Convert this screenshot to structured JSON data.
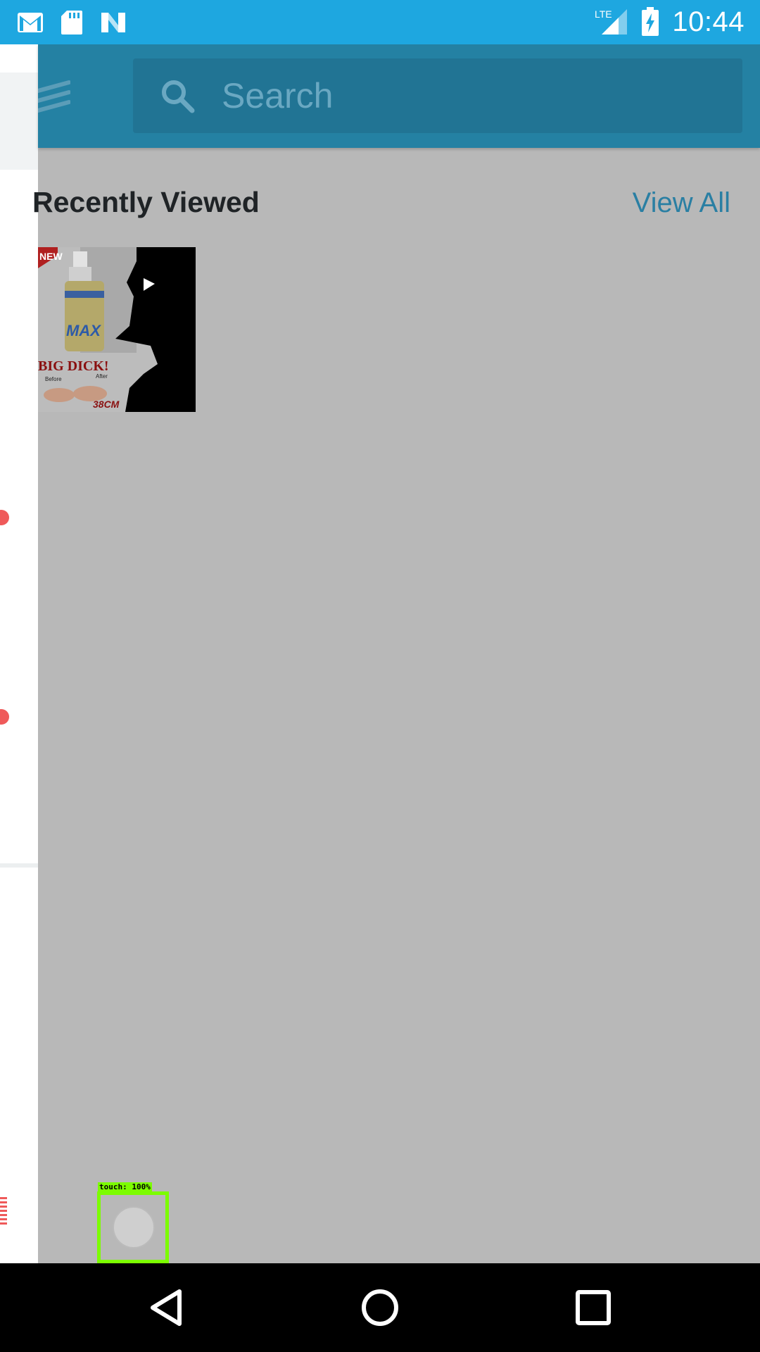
{
  "status_bar": {
    "time": "10:44",
    "network": "LTE",
    "icons": [
      "gmail-icon",
      "sd-card-icon",
      "n-icon",
      "lte-signal-icon",
      "battery-charging-icon"
    ]
  },
  "toolbar": {
    "search_placeholder": "Search"
  },
  "recently_viewed": {
    "title": "Recently Viewed",
    "view_all": "View All",
    "items": [
      {
        "image_text": [
          "NEW",
          "MAX",
          "BIG DICK!",
          "38CM",
          "Before",
          "After"
        ]
      }
    ]
  },
  "debug_overlay": {
    "touch_label": "touch: 100%"
  },
  "colors": {
    "status_bar": "#1ea7e0",
    "toolbar": "#2481a3",
    "scrim": "#b8b8b8",
    "accent_red": "#ef5a5a",
    "touch_green": "#7cfc00"
  },
  "nav_bar": {
    "buttons": [
      "back-icon",
      "home-icon",
      "recents-icon"
    ]
  }
}
